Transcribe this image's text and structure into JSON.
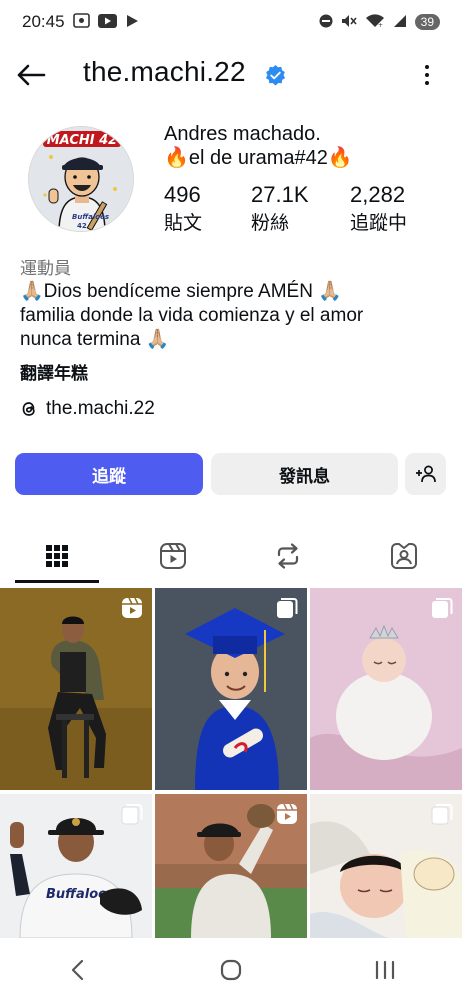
{
  "status_bar": {
    "time": "20:45",
    "left_icons": [
      "screenshot-icon",
      "youtube-icon",
      "play-icon"
    ],
    "right_icons": [
      "do-not-disturb-icon",
      "mute-icon",
      "wifi-icon",
      "signal-icon"
    ],
    "battery": "39"
  },
  "header": {
    "username": "the.machi.22",
    "verified": true,
    "back_icon": "back-arrow-icon",
    "more_icon": "more-vertical-icon"
  },
  "profile": {
    "avatar_text": "MACHI 42",
    "name": "Andres machado.",
    "subtitle": "🔥el de urama#42🔥",
    "stats": [
      {
        "value": "496",
        "label": "貼文"
      },
      {
        "value": "27.1K",
        "label": "粉絲"
      },
      {
        "value": "2,282",
        "label": "追蹤中"
      }
    ],
    "category": "運動員",
    "bio_lines": [
      "🙏🏼Dios bendíceme siempre AMÉN 🙏🏼",
      "familia donde la vida comienza y el amor",
      "nunca termina 🙏🏼"
    ],
    "translate_label": "翻譯年糕",
    "threads_handle": "the.machi.22"
  },
  "actions": {
    "follow_label": "追蹤",
    "message_label": "發訊息",
    "add_user_icon": "add-person-icon"
  },
  "tabs": [
    {
      "name": "grid",
      "icon": "grid-icon",
      "active": true
    },
    {
      "name": "reels",
      "icon": "reels-icon",
      "active": false
    },
    {
      "name": "reposts",
      "icon": "repost-icon",
      "active": false
    },
    {
      "name": "tagged",
      "icon": "tagged-person-icon",
      "active": false
    }
  ],
  "posts": [
    {
      "type": "reel",
      "badge": "reels-icon"
    },
    {
      "type": "carousel",
      "badge": "carousel-icon"
    },
    {
      "type": "carousel",
      "badge": "carousel-icon"
    },
    {
      "type": "carousel",
      "badge": "carousel-icon"
    },
    {
      "type": "reel",
      "badge": "reels-icon"
    },
    {
      "type": "carousel",
      "badge": "carousel-icon"
    }
  ],
  "nav_bar": [
    "back-nav-icon",
    "home-nav-icon",
    "recents-nav-icon"
  ],
  "colors": {
    "follow_button": "#4f5cf0",
    "secondary_button": "#efefef",
    "verified_badge": "#2d8cf0"
  }
}
